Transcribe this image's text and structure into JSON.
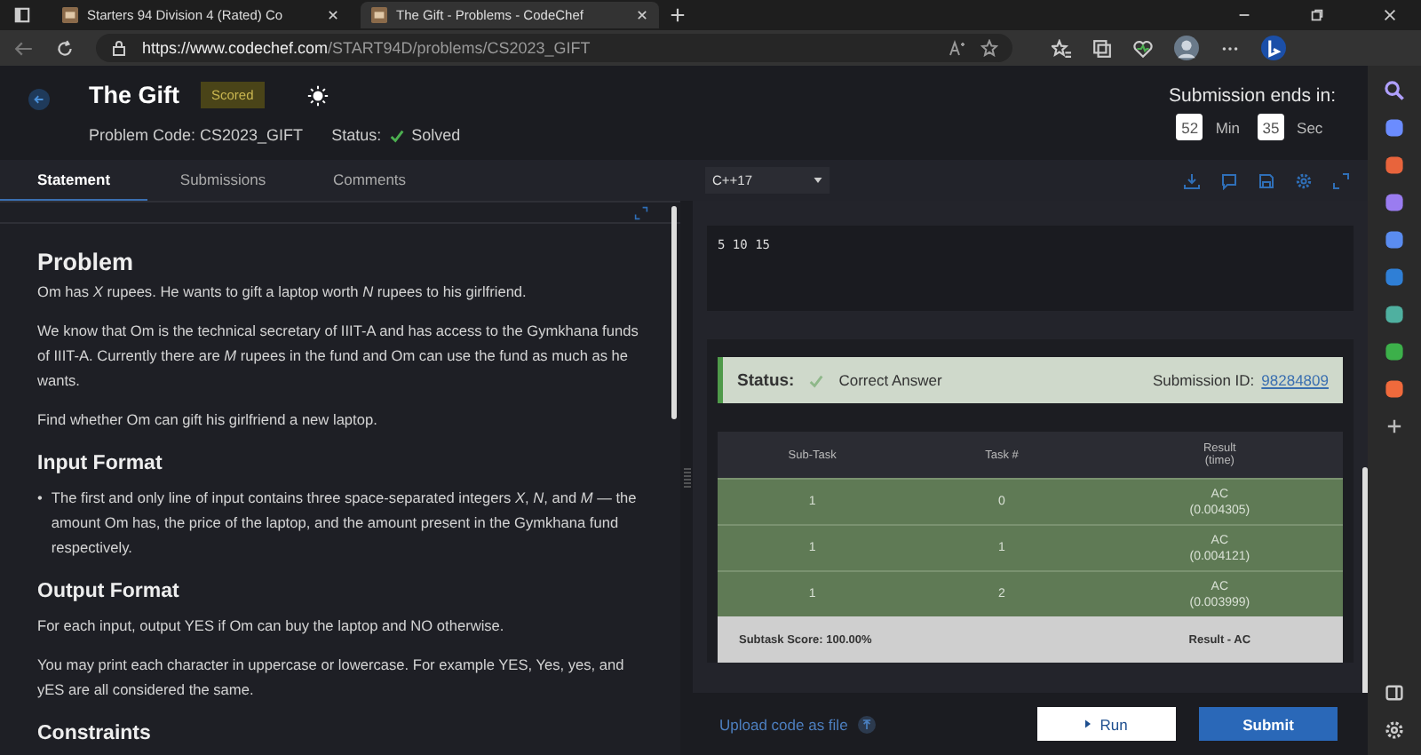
{
  "browser": {
    "tabs": [
      {
        "title": "Starters 94 Division 4 (Rated) Co",
        "selected": false
      },
      {
        "title": "The Gift - Problems - CodeChef",
        "selected": true
      }
    ],
    "url_host": "https://www.codechef.com",
    "url_path": "/START94D/problems/CS2023_GIFT"
  },
  "problem": {
    "title": "The Gift",
    "badge": "Scored",
    "code": "Problem Code: CS2023_GIFT",
    "status_label": "Status:",
    "status": "Solved",
    "solved": true
  },
  "timer": {
    "label": "Submission ends in:",
    "units": [
      {
        "value": "52",
        "unit": "Min"
      },
      {
        "value": "35",
        "unit": "Sec"
      }
    ]
  },
  "tabs": [
    {
      "label": "Statement",
      "selected": true
    },
    {
      "label": "Submissions",
      "selected": false
    },
    {
      "label": "Comments",
      "selected": false
    }
  ],
  "statement": [
    {
      "heading": "Problem",
      "kind": "paragraphs",
      "items": [
        "Om has *X* rupees. He wants to gift a laptop worth *N* rupees to his girlfriend.",
        "We know that Om is the technical secretary of IIIT-A and has access to the Gymkhana funds of IIIT-A. Currently there are *M* rupees in the fund and Om can use the fund as much as he wants.",
        "Find whether Om can gift his girlfriend a new laptop."
      ]
    },
    {
      "heading": "Input Format",
      "kind": "bullets",
      "marker": "•",
      "items": [
        "The first and only line of input contains three space-separated integers *X*, *N*, and *M* — the amount Om has, the price of the laptop, and the amount present in the Gymkhana fund respectively."
      ]
    },
    {
      "heading": "Output Format",
      "kind": "paragraphs",
      "items": [
        "For each input, output YES if Om can buy the laptop and NO otherwise.",
        "You may print each character in uppercase or lowercase. For example YES, Yes, yes, and yES are all considered the same."
      ]
    },
    {
      "heading": "Constraints",
      "kind": "heading"
    }
  ],
  "editor": {
    "language": "C++17",
    "custom_input": "5 10 15"
  },
  "result": {
    "status_label": "Status:",
    "status": "Correct Answer",
    "submission_label": "Submission ID:",
    "submission_id": "98284809",
    "columns": [
      {
        "label": "Sub-Task"
      },
      {
        "label": "Task #"
      },
      {
        "label": "Result",
        "sub": "(time)"
      }
    ],
    "rows": [
      {
        "subtask": "1",
        "task": "0",
        "result": "AC",
        "time": "(0.004305)"
      },
      {
        "subtask": "1",
        "task": "1",
        "result": "AC",
        "time": "(0.004121)"
      },
      {
        "subtask": "1",
        "task": "2",
        "result": "AC",
        "time": "(0.003999)"
      }
    ],
    "score": "Subtask Score: 100.00%",
    "verdict": "Result - AC"
  },
  "actions": {
    "upload": "Upload code as file",
    "run": "Run",
    "submit": "Submit"
  }
}
